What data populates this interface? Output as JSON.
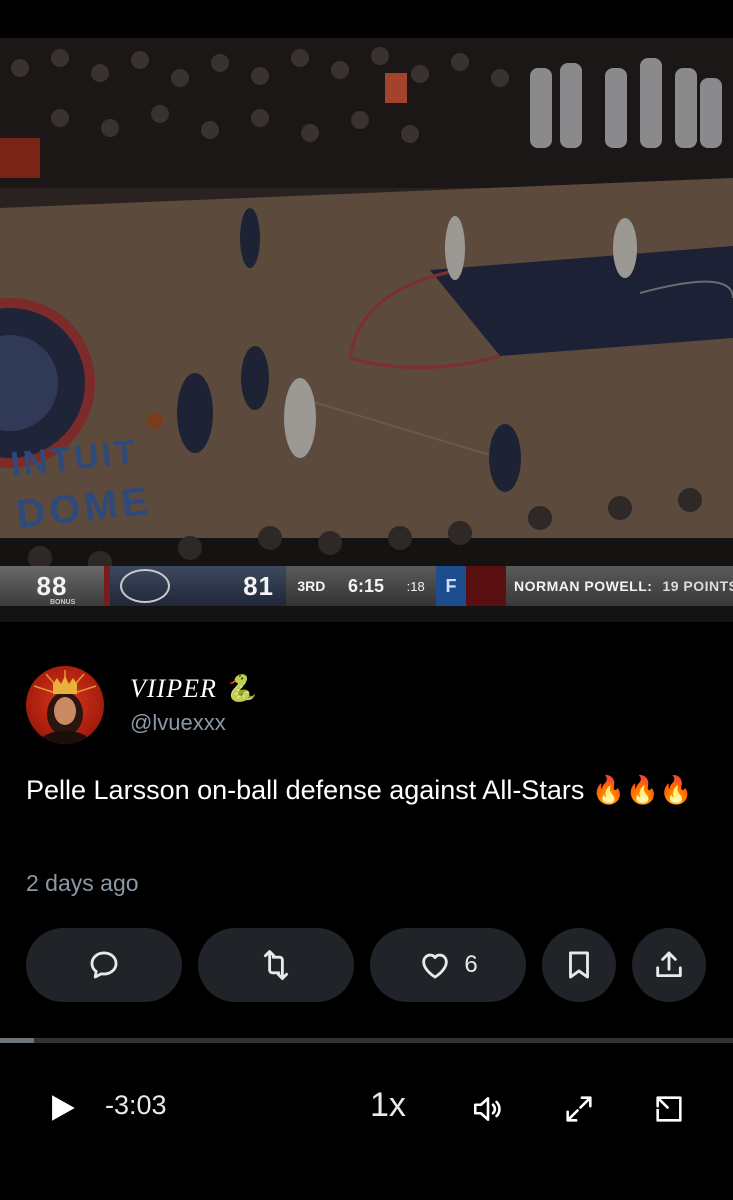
{
  "video": {
    "scoreboard": {
      "home_score": "88",
      "home_sub": "BONUS",
      "away_score": "81",
      "quarter": "3RD",
      "clock": "6:15",
      "shot_clock": ":18",
      "fanduel_glyph": "F",
      "player_info": "NORMAN POWELL:",
      "player_points": "19 POINTS"
    },
    "court_text": "INTUIT DOME"
  },
  "tweet": {
    "author_name": "VIIPER 🐍",
    "author_handle": "@lvuexxx",
    "text": "Pelle Larsson on-ball defense against All-Stars 🔥🔥🔥",
    "timestamp": "2 days ago"
  },
  "actions": {
    "reply_icon": "reply-icon",
    "repost_icon": "repost-icon",
    "like_icon": "heart-icon",
    "like_count": "6",
    "bookmark_icon": "bookmark-icon",
    "share_icon": "share-icon"
  },
  "player": {
    "progress": 0.047,
    "time_remaining": "-3:03",
    "speed": "1x"
  },
  "colors": {
    "background": "#000000",
    "button_bg": "#202327",
    "secondary_text": "#8b98a5"
  }
}
